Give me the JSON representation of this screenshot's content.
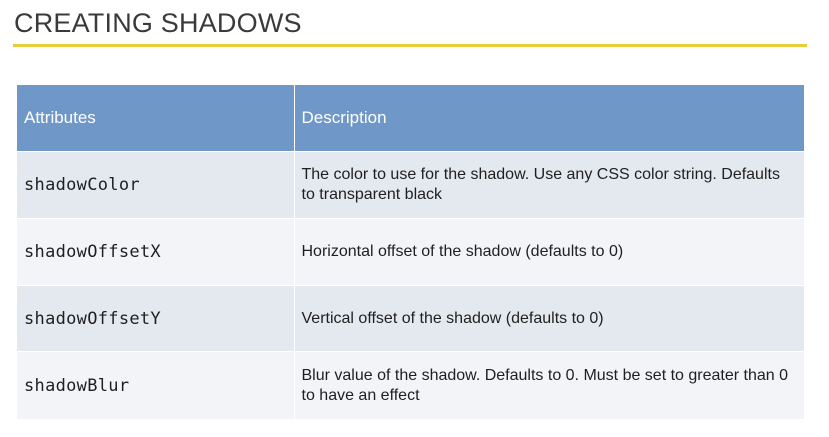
{
  "title": "CREATING SHADOWS",
  "table": {
    "headers": [
      "Attributes",
      "Description"
    ],
    "rows": [
      {
        "attribute": "shadowColor",
        "description": "The color to use for the shadow. Use any CSS color string. Defaults to transparent black"
      },
      {
        "attribute": "shadowOffsetX",
        "description": "Horizontal offset of the shadow (defaults to 0)"
      },
      {
        "attribute": "shadowOffsetY",
        "description": "Vertical offset of the shadow (defaults to 0)"
      },
      {
        "attribute": "shadowBlur",
        "description": "Blur value of the shadow. Defaults to 0. Must be set to greater than 0 to have an effect"
      }
    ]
  },
  "colors": {
    "title_rule": "#e8cd38",
    "header_background": "#6f98c9",
    "row_odd": "#e4e8ef",
    "row_even": "#f3f4f7"
  }
}
